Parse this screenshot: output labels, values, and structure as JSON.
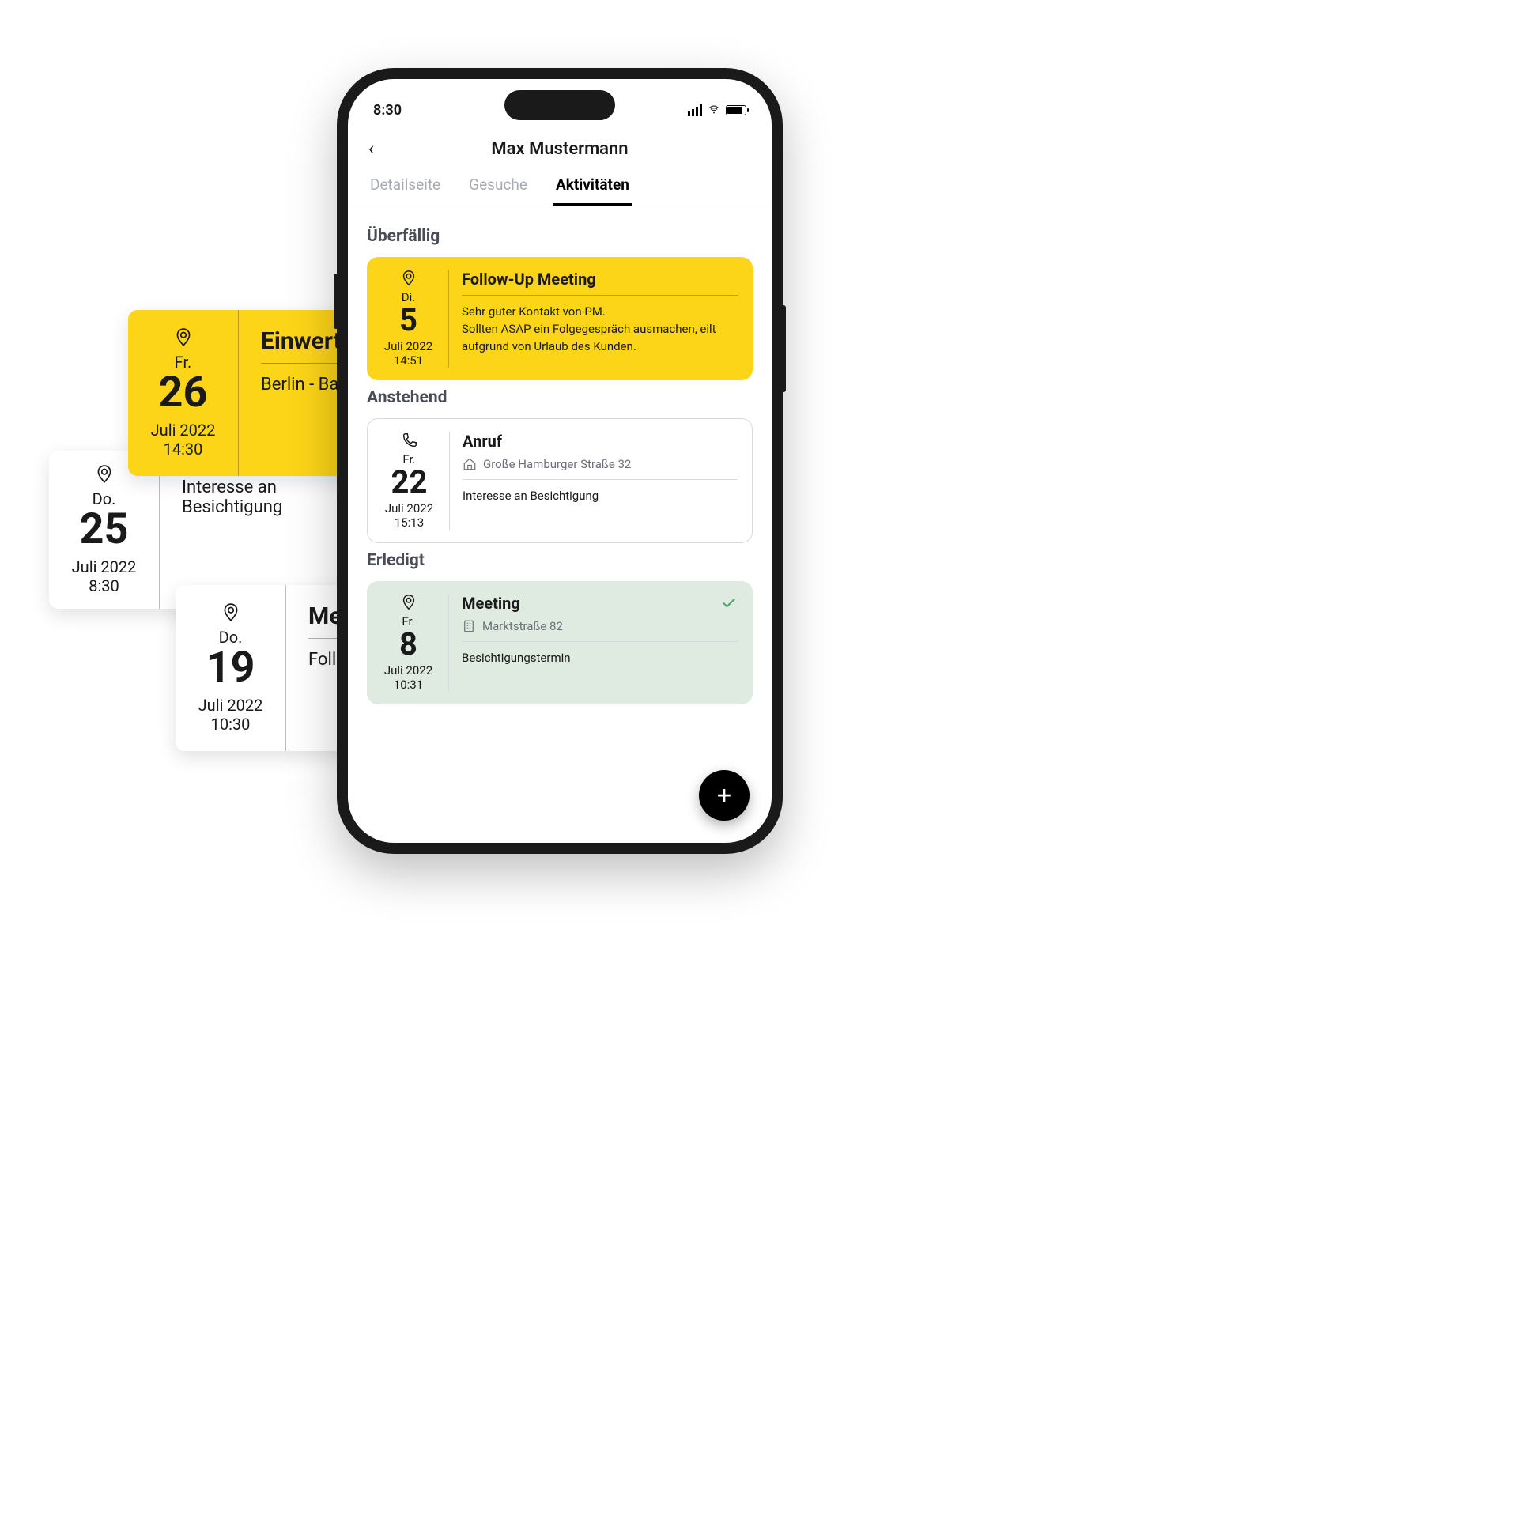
{
  "status": {
    "time": "8:30"
  },
  "header": {
    "title": "Max Mustermann"
  },
  "tabs": [
    {
      "label": "Detailseite",
      "active": false
    },
    {
      "label": "Gesuche",
      "active": false
    },
    {
      "label": "Aktivitäten",
      "active": true
    }
  ],
  "sections": {
    "overdue": {
      "title": "Überfällig",
      "item": {
        "icon": "pin-icon",
        "dow": "Di.",
        "day": "5",
        "month_year": "Juli 2022",
        "time": "14:51",
        "title": "Follow-Up Meeting",
        "body": "Sehr guter Kontakt von PM.\nSollten ASAP ein Folgegespräch ausmachen, eilt aufgrund von Urlaub des Kunden."
      }
    },
    "upcoming": {
      "title": "Anstehend",
      "item": {
        "icon": "phone-icon",
        "dow": "Fr.",
        "day": "22",
        "month_year": "Juli 2022",
        "time": "15:13",
        "title": "Anruf",
        "addr_icon": "house-icon",
        "address": "Große Hamburger Straße 32",
        "body": "Interesse an Besichtigung"
      }
    },
    "done": {
      "title": "Erledigt",
      "item": {
        "icon": "pin-icon",
        "dow": "Fr.",
        "day": "8",
        "month_year": "Juli 2022",
        "time": "10:31",
        "title": "Meeting",
        "addr_icon": "building-icon",
        "address": "Marktstraße 82",
        "body": "Besichtigungstermin"
      }
    }
  },
  "fab": {
    "label": "+"
  },
  "bg_cards": [
    {
      "style": "yellow",
      "icon": "pin-icon",
      "dow": "Fr.",
      "day": "26",
      "month_year": "Juli 2022",
      "time": "14:30",
      "title": "Einwertu",
      "body": "Berlin - Bachs"
    },
    {
      "style": "white",
      "icon": "pin-icon",
      "dow": "Do.",
      "day": "25",
      "month_year": "Juli 2022",
      "time": "8:30",
      "title": "",
      "body": "Interesse an Besichtigung"
    },
    {
      "style": "white",
      "icon": "pin-icon",
      "dow": "Do.",
      "day": "19",
      "month_year": "Juli 2022",
      "time": "10:30",
      "title": "Mee",
      "body": "Follow"
    }
  ]
}
